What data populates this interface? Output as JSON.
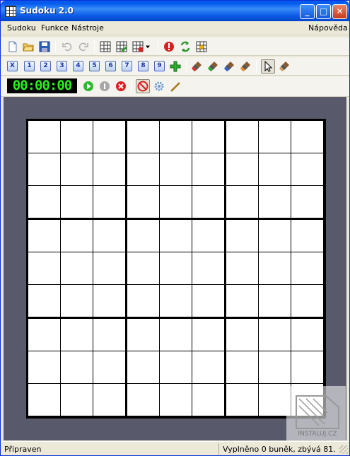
{
  "window": {
    "title": "Sudoku 2.0"
  },
  "menu": {
    "items": [
      "Sudoku",
      "Funkce",
      "Nástroje"
    ],
    "help": "Nápověda"
  },
  "number_bar": {
    "clear": "X",
    "numbers": [
      "1",
      "2",
      "3",
      "4",
      "5",
      "6",
      "7",
      "8",
      "9"
    ]
  },
  "timer": {
    "value": "00:00:00"
  },
  "board": {
    "rows": 9,
    "cols": 9,
    "filled_cells": 0
  },
  "watermark": {
    "text": "INSTALUJ.CZ"
  },
  "status": {
    "left": "Připraven",
    "right": "Vyplněno 0 buněk, zbývá 81."
  },
  "colors": {
    "title_bar": "#0058ee",
    "timer_digits": "#2cf21c",
    "client_bg": "#585a6c",
    "chrome": "#ece9d8"
  }
}
